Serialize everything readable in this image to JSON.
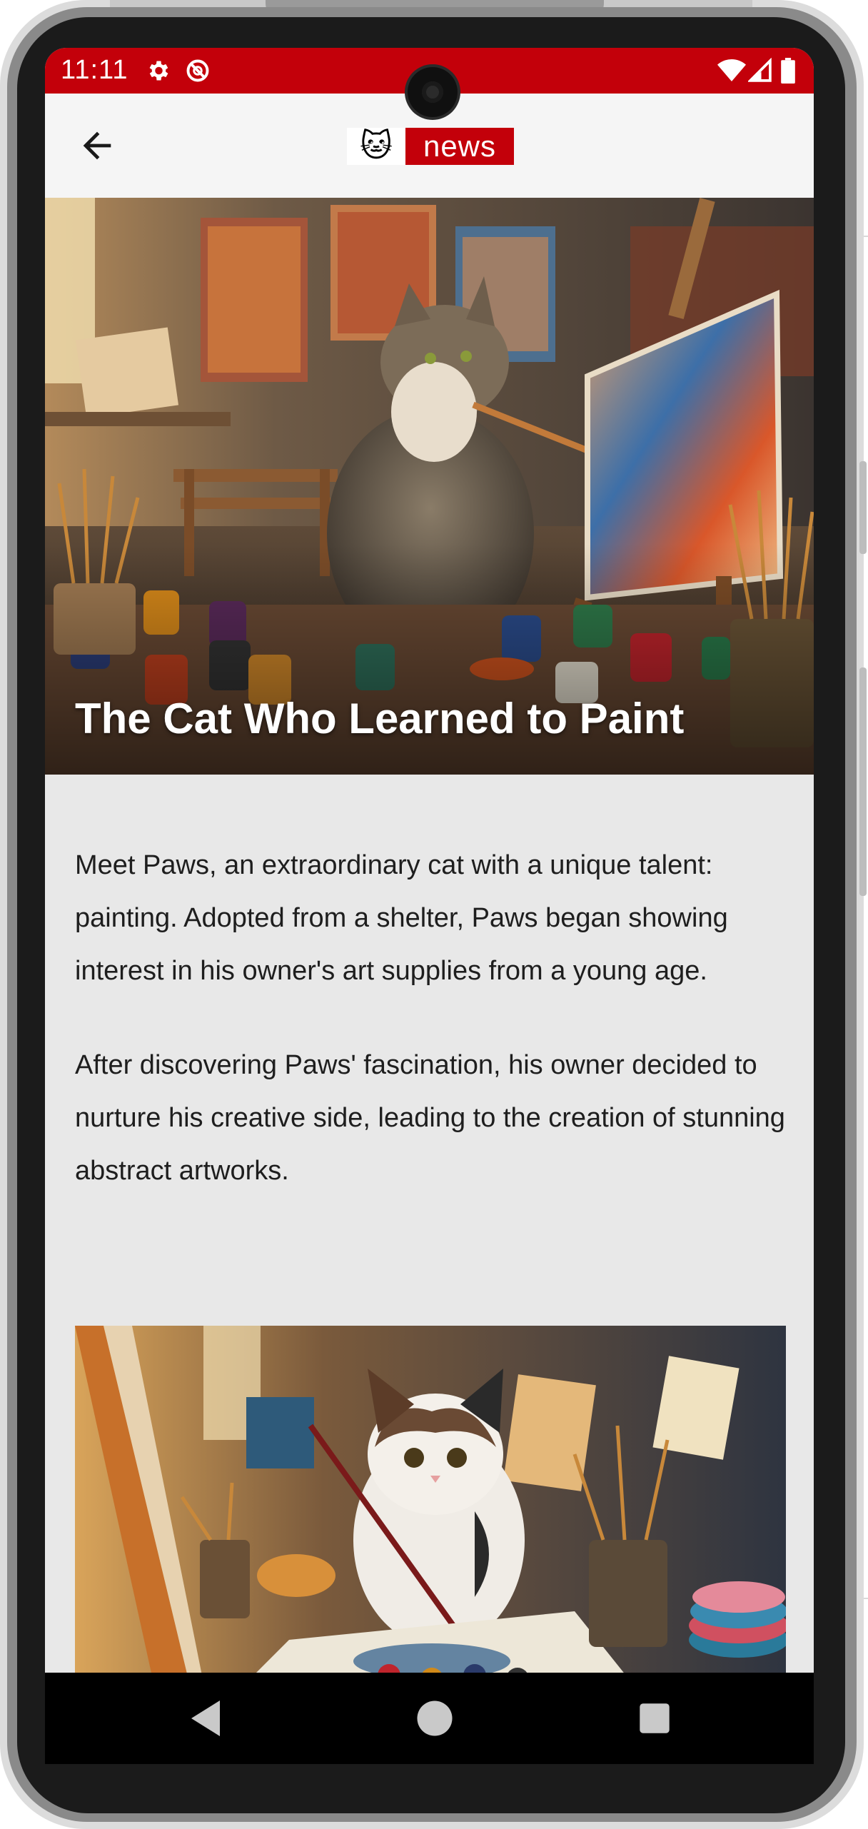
{
  "status_bar": {
    "time": "11:11",
    "background_color": "#c3000a",
    "left_icons": [
      "gear-icon",
      "no-disturb-icon"
    ],
    "right_icons": [
      "wifi-icon",
      "cellular-signal-icon",
      "battery-icon"
    ]
  },
  "app_bar": {
    "back_icon": "arrow-left-icon",
    "logo_emoji": "🐱",
    "logo_text": "news",
    "brand_color": "#c3000a"
  },
  "article": {
    "title": "The Cat Who Learned to Paint",
    "hero_image": "cat-painting-at-easel-image",
    "paragraphs": [
      "Meet Paws, an extraordinary cat with a unique talent: painting. Adopted from a shelter, Paws began showing interest in his owner's art supplies from a young age.",
      "After discovering Paws' fascination, his owner decided to nurture his creative side, leading to the creation of stunning abstract artworks."
    ],
    "second_image": "calico-cat-with-paintbrush-image"
  },
  "nav_bar": {
    "buttons": [
      "back-triangle-icon",
      "home-circle-icon",
      "recents-square-icon"
    ]
  }
}
